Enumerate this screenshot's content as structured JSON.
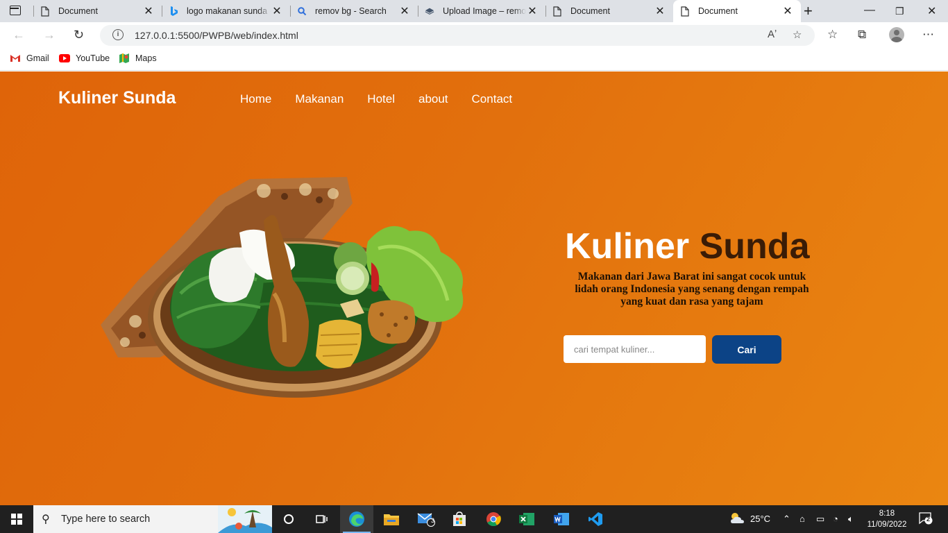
{
  "browser": {
    "tabs": [
      {
        "title": "Document",
        "icon": "document-icon"
      },
      {
        "title": "logo makanan sunda - Search",
        "icon": "bing-icon"
      },
      {
        "title": "remov bg - Search",
        "icon": "search-icon"
      },
      {
        "title": "Upload Image – remove.bg",
        "icon": "removebg-icon"
      },
      {
        "title": "Document",
        "icon": "document-icon"
      },
      {
        "title": "Document",
        "icon": "document-icon",
        "active": true
      }
    ],
    "url": "127.0.0.1:5500/PWPB/web/index.html",
    "bookmarks": [
      {
        "label": "Gmail",
        "icon": "gmail-icon"
      },
      {
        "label": "YouTube",
        "icon": "youtube-icon"
      },
      {
        "label": "Maps",
        "icon": "maps-icon"
      }
    ]
  },
  "site": {
    "brand": "Kuliner Sunda",
    "nav": [
      "Home",
      "Makanan",
      "Hotel",
      "about",
      "Contact"
    ],
    "hero": {
      "title_part1": "Kuliner",
      "title_part2": "Sunda",
      "description": "Makanan dari Jawa Barat ini sangat cocok untuk lidah orang Indonesia yang senang dengan rempah yang kuat dan rasa yang tajam",
      "search_placeholder": "cari tempat kuliner...",
      "search_button": "Cari",
      "image": "nasi-timbel-sunda"
    },
    "colors": {
      "background": "#e2700d",
      "accent_text": "#3a1c06",
      "button": "#0c4386"
    }
  },
  "taskbar": {
    "search_placeholder": "Type here to search",
    "mail_badge": "3",
    "weather": "25°C",
    "time": "8:18",
    "date": "11/09/2022",
    "notifications": "2"
  }
}
